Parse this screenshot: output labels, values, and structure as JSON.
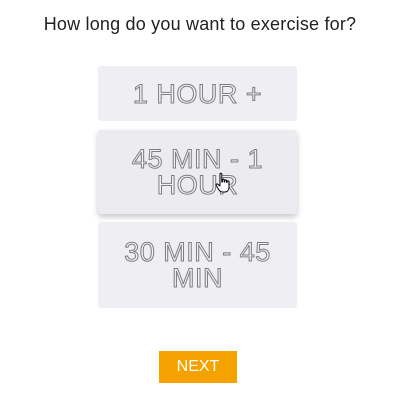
{
  "question": "How long do you want to exercise for?",
  "options": [
    {
      "label": "1 HOUR +"
    },
    {
      "label": "45 MIN - 1 HOUR",
      "hovered": true
    },
    {
      "label": "30 MIN - 45 MIN"
    }
  ],
  "next_button": {
    "label": "NEXT"
  },
  "colors": {
    "option_bg": "#efeff3",
    "next_button_bg": "#f5a200",
    "question_text": "#222222"
  },
  "icons": [
    "hand-pointer-cursor-icon"
  ]
}
